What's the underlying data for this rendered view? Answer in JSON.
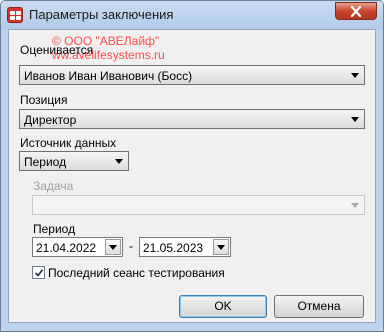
{
  "window": {
    "title": "Параметры заключения"
  },
  "watermark": {
    "line1": "© ООО \"АВЕЛайф\"",
    "line2": "ww.avelifesystems.ru"
  },
  "evaluated": {
    "label": "Оценивается",
    "value": "Иванов Иван Иванович (Босс)"
  },
  "position": {
    "label": "Позиция",
    "value": "Директор"
  },
  "data_source": {
    "label": "Источник данных",
    "value": "Период"
  },
  "task": {
    "label": "Задача",
    "value": ""
  },
  "period": {
    "label": "Период",
    "from": "21.04.2022",
    "separator": "-",
    "to": "21.05.2023"
  },
  "last_session": {
    "label": "Последний сеанс тестирования",
    "checked": true
  },
  "buttons": {
    "ok": "OK",
    "cancel": "Отмена"
  },
  "colors": {
    "close_button": "#c7452e",
    "title_bar": "#bcd3ee",
    "watermark": "#ff4a4a"
  }
}
